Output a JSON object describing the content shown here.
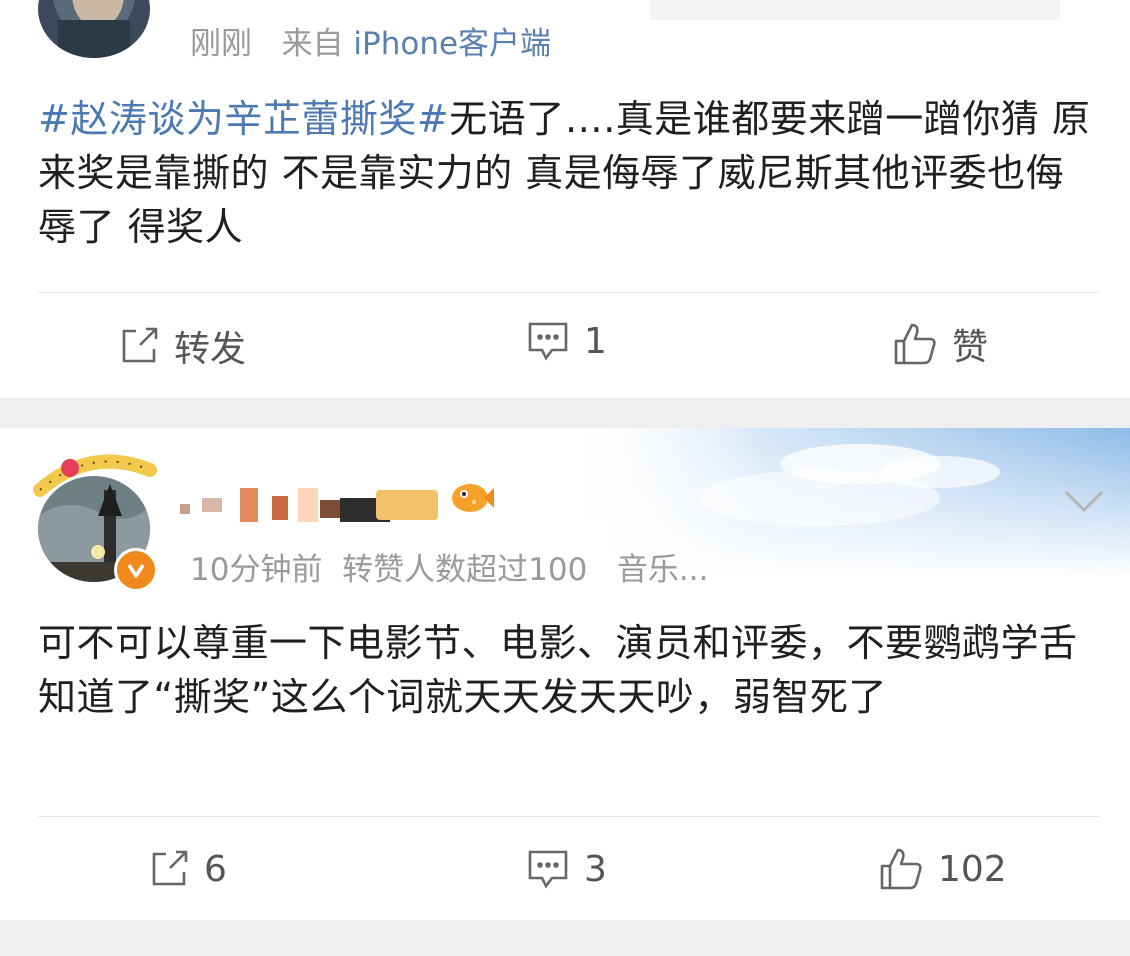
{
  "post1": {
    "time": "刚刚",
    "source_prefix": "来自",
    "source_client": "iPhone客户端",
    "hashtag": "#赵涛谈为辛芷蕾撕奖#",
    "content_after_tag": "无语了….真是谁都要来蹭一蹭你猜 原来奖是靠撕的 不是靠实力的 真是侮辱了威尼斯其他评委也侮辱了 得奖人",
    "actions": {
      "repost": {
        "icon": "share-square-icon",
        "label": "转发"
      },
      "comment": {
        "icon": "comment-bubble-icon",
        "label": "1"
      },
      "like": {
        "icon": "thumbs-up-icon",
        "label": "赞"
      }
    }
  },
  "post2": {
    "time": "10分钟前",
    "badge_text": "转赞人数超过100",
    "source": "音乐...",
    "content": "可不可以尊重一下电影节、电影、演员和评委，不要鹦鹉学舌知道了“撕奖”这么个词就天天发天天吵，弱智死了",
    "actions": {
      "repost": {
        "icon": "share-square-icon",
        "label": "6"
      },
      "comment": {
        "icon": "comment-bubble-icon",
        "label": "3"
      },
      "like": {
        "icon": "thumbs-up-icon",
        "label": "102"
      }
    }
  },
  "colors": {
    "hashtag": "#4c78b3",
    "meta": "#9a9a9a",
    "verified_badge": "#f08a1c",
    "background": "#efefef"
  }
}
